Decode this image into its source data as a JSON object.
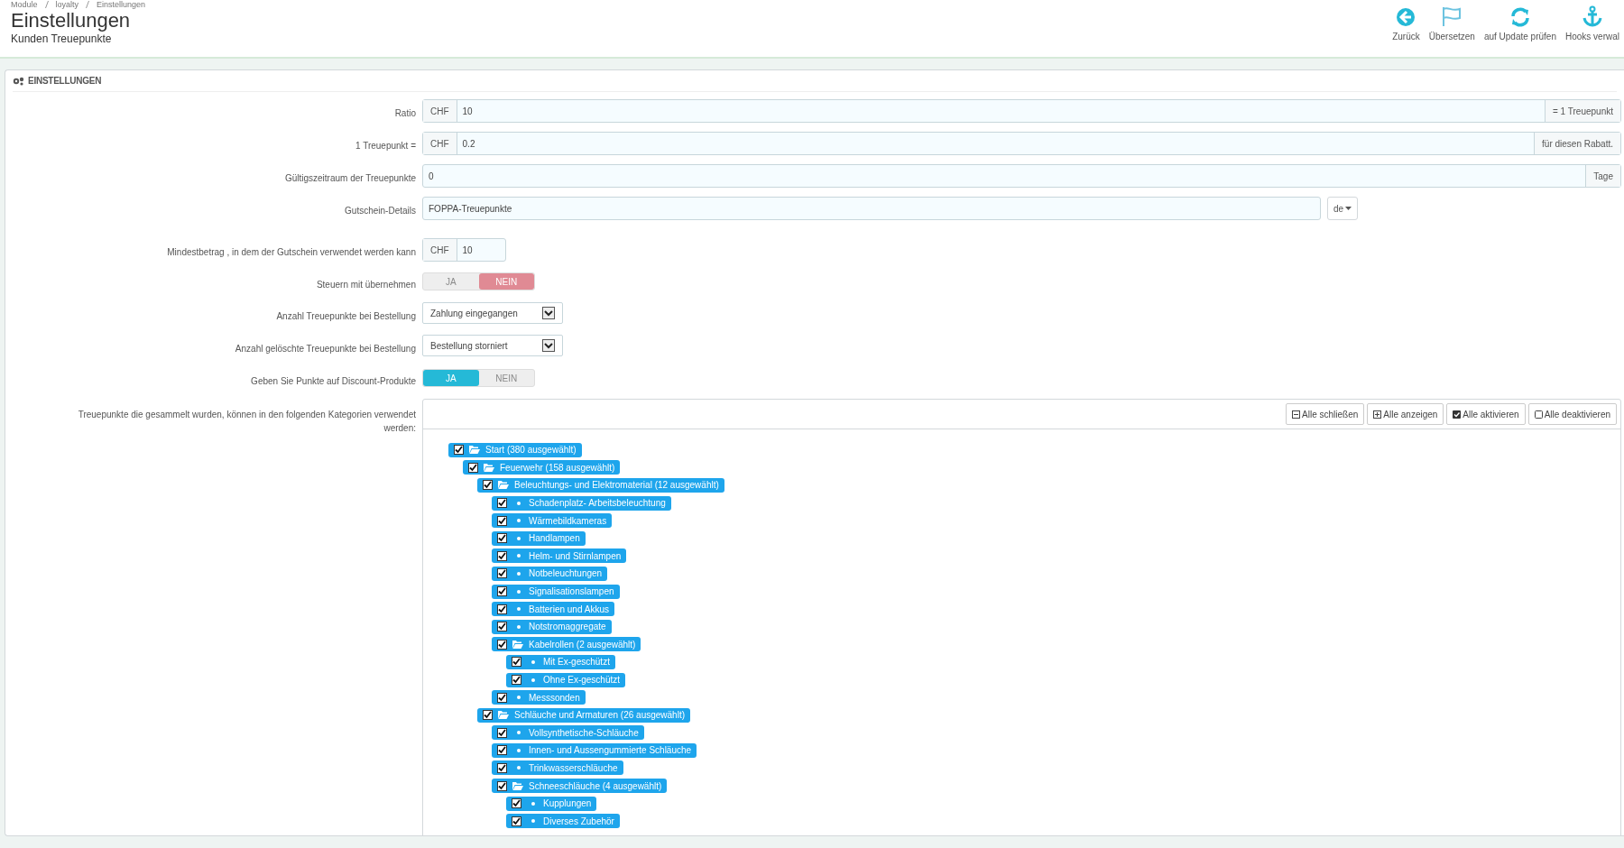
{
  "breadcrumb": [
    "Module",
    "loyalty",
    "Einstellungen"
  ],
  "header": {
    "title": "Einstellungen",
    "subtitle": "Kunden Treuepunkte"
  },
  "toolbar": [
    {
      "kind": "back",
      "label": "Zurück"
    },
    {
      "kind": "flag",
      "label": "Übersetzen"
    },
    {
      "kind": "refresh",
      "label": "auf Update prüfen"
    },
    {
      "kind": "anchor",
      "label": "Hooks verwal"
    }
  ],
  "panel": {
    "title": "EINSTELLUNGEN",
    "fields": [
      {
        "kind": "input",
        "label": "Ratio",
        "prefix": "CHF",
        "value": "10",
        "suffix": "= 1 Treuepunkt"
      },
      {
        "kind": "input",
        "label": "1 Treuepunkt =",
        "prefix": "CHF",
        "value": "0.2",
        "suffix": "für diesen Rabatt."
      },
      {
        "kind": "input",
        "label": "Gültigszeitraum der Treuepunkte",
        "value": "0",
        "suffix": "Tage"
      },
      {
        "kind": "lang",
        "label": "Gutschein-Details",
        "value": "FOPPA-Treuepunkte",
        "lang": "de"
      },
      {
        "kind": "short",
        "label": "Mindestbetrag , in dem der Gutschein verwendet werden kann",
        "prefix": "CHF",
        "value": "10"
      },
      {
        "kind": "toggle",
        "label": "Steuern mit übernehmen",
        "options": [
          {
            "label": "JA",
            "selected": false
          },
          {
            "label": "NEIN",
            "selected": true
          }
        ]
      },
      {
        "kind": "select",
        "label": "Anzahl Treuepunkte bei Bestellung",
        "value": "Zahlung eingegangen"
      },
      {
        "kind": "select",
        "label": "Anzahl gelöschte Treuepunkte bei Bestellung",
        "value": "Bestellung storniert"
      },
      {
        "kind": "toggle",
        "label": "Geben Sie Punkte auf Discount-Produkte",
        "options": [
          {
            "label": "JA",
            "selected": true
          },
          {
            "label": "NEIN",
            "selected": false
          }
        ]
      },
      {
        "kind": "tree",
        "label": "Treuepunkte die gesammelt wurden, können in den folgenden Kategorien verwendet werden:",
        "buttons": [
          {
            "kind": "collapse",
            "label": "Alle schließen"
          },
          {
            "kind": "expand",
            "label": "Alle anzeigen"
          },
          {
            "kind": "check",
            "label": "Alle aktivieren"
          },
          {
            "kind": "uncheck",
            "label": "Alle deaktivieren"
          }
        ],
        "nodes": [
          {
            "label": "Start (380 ausgewählt)",
            "checked": true,
            "children": [
              {
                "label": "Feuerwehr (158 ausgewählt)",
                "checked": true,
                "children": [
                  {
                    "label": "Beleuchtungs- und Elektromaterial (12 ausgewählt)",
                    "checked": true,
                    "children": [
                      {
                        "label": "Schadenplatz- Arbeitsbeleuchtung",
                        "checked": true
                      },
                      {
                        "label": "Wärmebildkameras",
                        "checked": true
                      },
                      {
                        "label": "Handlampen",
                        "checked": true
                      },
                      {
                        "label": "Helm- und Stirnlampen",
                        "checked": true
                      },
                      {
                        "label": "Notbeleuchtungen",
                        "checked": true
                      },
                      {
                        "label": "Signalisationslampen",
                        "checked": true
                      },
                      {
                        "label": "Batterien und Akkus",
                        "checked": true
                      },
                      {
                        "label": "Notstromaggregate",
                        "checked": true
                      },
                      {
                        "label": "Kabelrollen (2 ausgewählt)",
                        "checked": true,
                        "children": [
                          {
                            "label": "Mit Ex-geschützt",
                            "checked": true
                          },
                          {
                            "label": "Ohne Ex-geschützt",
                            "checked": true
                          }
                        ]
                      },
                      {
                        "label": "Messsonden",
                        "checked": true
                      }
                    ]
                  },
                  {
                    "label": "Schläuche und Armaturen (26 ausgewählt)",
                    "checked": true,
                    "children": [
                      {
                        "label": "Vollsynthetische-Schläuche",
                        "checked": true
                      },
                      {
                        "label": "Innen- und Aussengummierte Schläuche",
                        "checked": true
                      },
                      {
                        "label": "Trinkwasserschläuche",
                        "checked": true
                      },
                      {
                        "label": "Schneeschläuche (4 ausgewählt)",
                        "checked": true,
                        "children": [
                          {
                            "label": "Kupplungen",
                            "checked": true
                          },
                          {
                            "label": "Diverses Zubehör",
                            "checked": true
                          }
                        ]
                      }
                    ]
                  }
                ]
              }
            ]
          }
        ]
      }
    ]
  }
}
